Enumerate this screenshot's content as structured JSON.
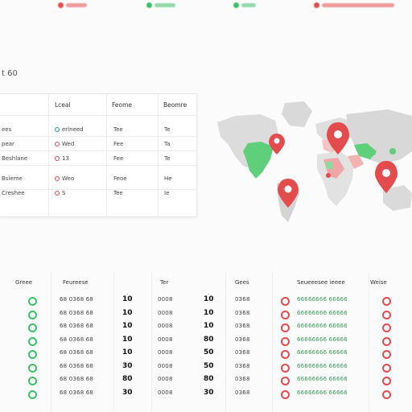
{
  "top_pills": [
    {
      "color": "#e24c4c"
    },
    {
      "color": "#3cbf6a"
    },
    {
      "color": "#3cbf6a"
    },
    {
      "color": "#e24c4c"
    }
  ],
  "title": "t 60",
  "card": {
    "headers": [
      "Lceal",
      "Feome",
      "Beomre"
    ],
    "rows": [
      {
        "name": "ees",
        "value": "erlneed",
        "status": "green",
        "col2": "Tee",
        "col3": "Te"
      },
      {
        "name": "pear",
        "value": "Wed",
        "status": "red",
        "col2": "Fee",
        "col3": "Ta"
      },
      {
        "name": "Beshlane",
        "value": "13",
        "status": "red",
        "col2": "Fee",
        "col3": "Te"
      },
      {
        "name": "Bsieme",
        "value": "Weo",
        "status": "red",
        "col2": "Feoe",
        "col3": "He"
      },
      {
        "name": "Creshee",
        "value": "S",
        "status": "red",
        "col2": "Tee",
        "col3": "Ie"
      }
    ]
  },
  "map": {
    "pins": [
      {
        "color": "#e24c4c"
      },
      {
        "color": "#e24c4c"
      },
      {
        "color": "#e24c4c"
      },
      {
        "color": "#e24c4c"
      }
    ]
  },
  "table": {
    "headers": [
      "Greee",
      "Feureese",
      "Ter",
      "Gees",
      "Seueeesee ieeee",
      "Weise"
    ],
    "rows": [
      {
        "left": "green",
        "code": "68 0368 68",
        "n1": "10",
        "sub": "0008",
        "n2": "10",
        "code2": "0368",
        "right": "red",
        "long": "66666666 66666"
      },
      {
        "left": "green",
        "code": "68 0368 68",
        "n1": "10",
        "sub": "0008",
        "n2": "10",
        "code2": "0368",
        "right": "red",
        "long": "66666666 66666"
      },
      {
        "left": "green",
        "code": "68 0368 68",
        "n1": "10",
        "sub": "0008",
        "n2": "10",
        "code2": "0368",
        "right": "red",
        "long": "66666666 66666"
      },
      {
        "left": "green",
        "code": "68 0368 68",
        "n1": "10",
        "sub": "0008",
        "n2": "80",
        "code2": "0368",
        "right": "red",
        "long": "66666666 66666"
      },
      {
        "left": "green",
        "code": "68 0368 68",
        "n1": "10",
        "sub": "0008",
        "n2": "50",
        "code2": "0368",
        "right": "red",
        "long": "66666666 66666"
      },
      {
        "left": "green",
        "code": "68 0368 68",
        "n1": "30",
        "sub": "0008",
        "n2": "50",
        "code2": "0368",
        "right": "red",
        "long": "66666666 66666"
      },
      {
        "left": "green",
        "code": "68 0368 68",
        "n1": "80",
        "sub": "0008",
        "n2": "80",
        "code2": "0368",
        "right": "red",
        "long": "66666666 66666"
      },
      {
        "left": "green",
        "code": "68 0368 68",
        "n1": "30",
        "sub": "0008",
        "n2": "30",
        "code2": "0368",
        "right": "red",
        "long": "66666666 66666"
      }
    ]
  }
}
